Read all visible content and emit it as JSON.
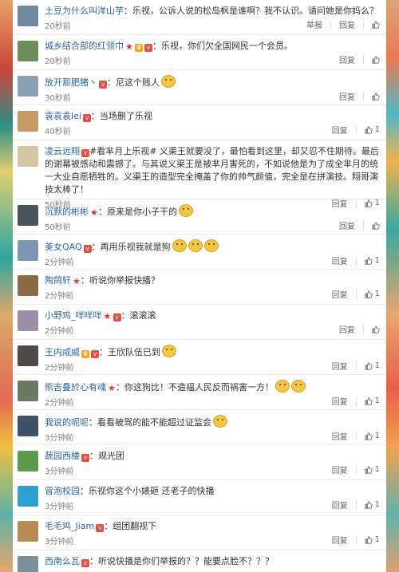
{
  "comments": [
    {
      "user": "土豆为什么叫洋山芋",
      "badges": [],
      "text": "：乐视，公诉人说的松岛枫是谁啊？我不认识。请问她是你妈么？",
      "time": "20秒前",
      "actions": [
        "举报",
        "回复"
      ],
      "like": "",
      "avatar": "#6f8a9d"
    },
    {
      "user": "城乡结合部的红领巾",
      "badges": [
        "star",
        "crown",
        "v"
      ],
      "text": "：乐视，你们欠全国网民一个会员。",
      "time": "20秒前",
      "actions": [
        "回复"
      ],
      "like": "",
      "avatar": "#6e8d59"
    },
    {
      "user": "放开那肥猪丶",
      "badges": [
        "v"
      ],
      "text": "：尼这个贱人",
      "emoji": 1,
      "time": "30秒前",
      "actions": [
        "回复"
      ],
      "like": "",
      "avatar": "#8aa0b3"
    },
    {
      "user": "袁袁袁lei",
      "badges": [
        "v"
      ],
      "text": "：当场删了乐视",
      "time": "40秒前",
      "actions": [
        "回复"
      ],
      "like": "1",
      "avatar": "#c49a66"
    },
    {
      "user": "凌云远翔",
      "badges": [
        "v"
      ],
      "text": "#看芈月上乐视# 义渠王就要没了，最怕看到这里，却又忍不住期待。最后的谢幕被感动和震撼了。与其说义渠王是被芈月害死的，不如说他是为了成全芈月的统一大业自愿牺牲的。义渠王的造型完全掩盖了你的帅气颜值，完全是在拼演技。翔哥演技太棒了！",
      "time": "50秒前",
      "actions": [
        "回复"
      ],
      "like": "1",
      "avatar": "#d6c6a0"
    },
    {
      "user": "沉默的彬彬",
      "badges": [
        "star"
      ],
      "text": "：原来是你小子干的",
      "emoji": 1,
      "time": "50秒前",
      "actions": [
        "回复"
      ],
      "like": "",
      "avatar": "#4a5560"
    },
    {
      "user": "美女QAQ",
      "badges": [
        "v"
      ],
      "text": "：再用乐视我就是狗",
      "emoji": 3,
      "time": "2分钟前",
      "actions": [
        "回复"
      ],
      "like": "1",
      "avatar": "#7f95b4"
    },
    {
      "user": "陶鸽轩",
      "badges": [
        "star"
      ],
      "text": "：听说你举报快播？",
      "time": "2分钟前",
      "actions": [
        "回复"
      ],
      "like": "1",
      "avatar": "#8d6a44"
    },
    {
      "user": "小野鸡_咩咩咩",
      "badges": [
        "star",
        "v"
      ],
      "text": "：滚滚滚",
      "time": "2分钟前",
      "actions": [
        "回复"
      ],
      "like": "",
      "avatar": "#9b8fa7"
    },
    {
      "user": "王内咸威",
      "badges": [
        "crown",
        "v"
      ],
      "text": "：王欣队伍已到",
      "emoji": 1,
      "time": "2分钟前",
      "actions": [
        "回复"
      ],
      "like": "1",
      "avatar": "#4f4a46"
    },
    {
      "user": "熊吉叠於心有魂",
      "badges": [
        "star"
      ],
      "text": "：你这狗比！不造福人民反而祸害一方！",
      "emoji": 2,
      "time": "2分钟前",
      "actions": [
        "回复"
      ],
      "like": "1",
      "avatar": "#6b7a62"
    },
    {
      "user": "我说的呢呢",
      "badges": [],
      "text": "：看看被驾的能不能超过证监会",
      "emoji": 1,
      "time": "3分钟前",
      "actions": [
        "回复"
      ],
      "like": "1",
      "avatar": "#3f5268"
    },
    {
      "user": "蔬园西楼",
      "badges": [
        "v"
      ],
      "text": "：观光团",
      "time": "3分钟前",
      "actions": [
        "回复"
      ],
      "like": "1",
      "avatar": "#5e9a4c"
    },
    {
      "user": "冒泡校园",
      "badges": [],
      "text": "：乐视你这个小婊砸 还老子的快播",
      "time": "3分钟前",
      "actions": [
        "回复"
      ],
      "like": "1",
      "avatar": "#2e9fd2"
    },
    {
      "user": "毛毛鸡_Jiam",
      "badges": [
        "v"
      ],
      "text": "：组团翻视下",
      "time": "3分钟前",
      "actions": [
        "回复"
      ],
      "like": "1",
      "avatar": "#b88a58"
    },
    {
      "user": "西南么瓦",
      "badges": [
        "v"
      ],
      "text": "：听说快播是你们举报的？？能要点脸不？？？",
      "time": "",
      "actions": [],
      "like": "",
      "avatar": "#7a8f9d"
    }
  ]
}
